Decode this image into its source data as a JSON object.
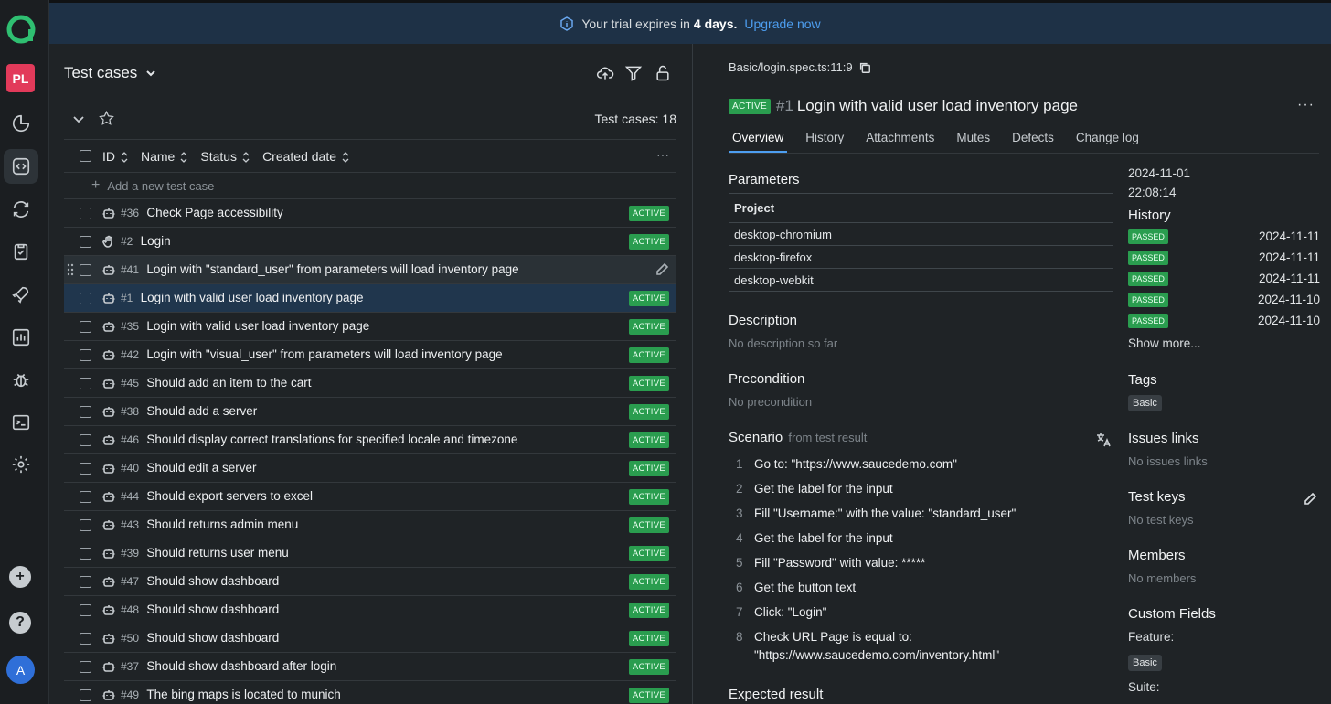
{
  "banner": {
    "text": "Your trial expires in",
    "days": "4 days.",
    "upgrade": "Upgrade now"
  },
  "rail": {
    "project_initials": "PL",
    "avatar": "A",
    "help": "?",
    "add": "+"
  },
  "left": {
    "title": "Test cases",
    "count_label": "Test cases: 18",
    "columns": {
      "id": "ID",
      "name": "Name",
      "status": "Status",
      "created": "Created date",
      "more": "···"
    },
    "add_placeholder": "Add a new test case",
    "rows": [
      {
        "id": "#36",
        "name": "Check Page accessibility",
        "status": "ACTIVE",
        "icon": "robot-icon"
      },
      {
        "id": "#2",
        "name": "Login",
        "status": "ACTIVE",
        "icon": "hand-icon"
      },
      {
        "id": "#41",
        "name": "Login with \"standard_user\" from parameters will load inventory page",
        "status": "",
        "icon": "robot-icon"
      },
      {
        "id": "#1",
        "name": "Login with valid user load inventory page",
        "status": "ACTIVE",
        "icon": "robot-icon"
      },
      {
        "id": "#35",
        "name": "Login with valid user load inventory page",
        "status": "ACTIVE",
        "icon": "robot-icon"
      },
      {
        "id": "#42",
        "name": "Login with \"visual_user\" from parameters will load inventory page",
        "status": "ACTIVE",
        "icon": "robot-icon"
      },
      {
        "id": "#45",
        "name": "Should add an item to the cart",
        "status": "ACTIVE",
        "icon": "robot-icon"
      },
      {
        "id": "#38",
        "name": "Should add a server",
        "status": "ACTIVE",
        "icon": "robot-icon"
      },
      {
        "id": "#46",
        "name": "Should display correct translations for specified locale and timezone",
        "status": "ACTIVE",
        "icon": "robot-icon"
      },
      {
        "id": "#40",
        "name": "Should edit a server",
        "status": "ACTIVE",
        "icon": "robot-icon"
      },
      {
        "id": "#44",
        "name": "Should export servers to excel",
        "status": "ACTIVE",
        "icon": "robot-icon"
      },
      {
        "id": "#43",
        "name": "Should returns admin menu",
        "status": "ACTIVE",
        "icon": "robot-icon"
      },
      {
        "id": "#39",
        "name": "Should returns user menu",
        "status": "ACTIVE",
        "icon": "robot-icon"
      },
      {
        "id": "#47",
        "name": "Should show dashboard",
        "status": "ACTIVE",
        "icon": "robot-icon"
      },
      {
        "id": "#48",
        "name": "Should show dashboard",
        "status": "ACTIVE",
        "icon": "robot-icon"
      },
      {
        "id": "#50",
        "name": "Should show dashboard",
        "status": "ACTIVE",
        "icon": "robot-icon"
      },
      {
        "id": "#37",
        "name": "Should show dashboard after login",
        "status": "ACTIVE",
        "icon": "robot-icon"
      },
      {
        "id": "#49",
        "name": "The bing maps is located to munich",
        "status": "ACTIVE",
        "icon": "robot-icon"
      }
    ]
  },
  "detail": {
    "path": "Basic/login.spec.ts:11:9",
    "status": "ACTIVE",
    "number": "#1",
    "title": "Login with valid user load inventory page",
    "more": "···",
    "tabs": [
      "Overview",
      "History",
      "Attachments",
      "Mutes",
      "Defects",
      "Change log"
    ],
    "parameters_label": "Parameters",
    "param_header": "Project",
    "params": [
      "desktop-chromium",
      "desktop-firefox",
      "desktop-webkit"
    ],
    "description_label": "Description",
    "description": "No description so far",
    "precondition_label": "Precondition",
    "precondition": "No precondition",
    "scenario_label": "Scenario",
    "scenario_sub": "from test result",
    "steps": [
      "Go to: \"https://www.saucedemo.com\"",
      "Get the label for the input",
      "Fill \"Username:\" with the value: \"standard_user\"",
      "Get the label for the input",
      "Fill \"Password\" with value: *****",
      "Get the button text",
      "Click: \"Login\"",
      "Check URL Page is equal to:",
      "\"https://www.saucedemo.com/inventory.html\""
    ],
    "step_numbers": [
      "1",
      "2",
      "3",
      "4",
      "5",
      "6",
      "7",
      "8"
    ],
    "expected_label": "Expected result",
    "created_date": "2024-11-01",
    "created_time": "22:08:14",
    "history_label": "History",
    "history": [
      {
        "status": "PASSED",
        "date": "2024-11-11"
      },
      {
        "status": "PASSED",
        "date": "2024-11-11"
      },
      {
        "status": "PASSED",
        "date": "2024-11-11"
      },
      {
        "status": "PASSED",
        "date": "2024-11-10"
      },
      {
        "status": "PASSED",
        "date": "2024-11-10"
      }
    ],
    "show_more": "Show more...",
    "tags_label": "Tags",
    "tag": "Basic",
    "issues_label": "Issues links",
    "issues": "No issues links",
    "keys_label": "Test keys",
    "keys": "No test keys",
    "members_label": "Members",
    "members": "No members",
    "custom_label": "Custom Fields",
    "feature_label": "Feature:",
    "feature_value": "Basic",
    "suite_label": "Suite:"
  }
}
